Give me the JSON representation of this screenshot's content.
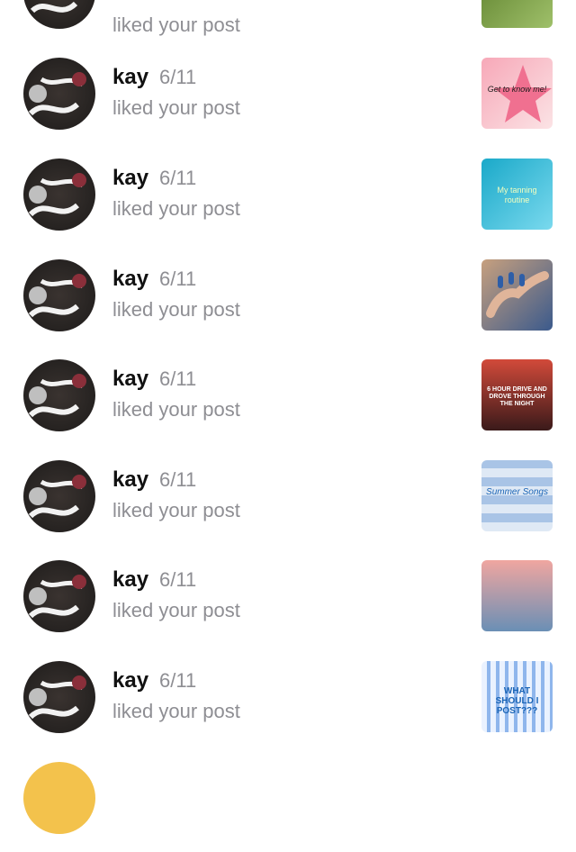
{
  "notifications": [
    {
      "name": "",
      "date": "",
      "action": "liked your post",
      "thumb": {
        "label": "",
        "colors": [
          "#5b7e2a",
          "#9fc06a"
        ]
      }
    },
    {
      "name": "kay",
      "date": "6/11",
      "action": "liked your post",
      "thumb": {
        "label": "Get to know me!",
        "colors": [
          "#f7a8b8",
          "#fbe3e5"
        ]
      }
    },
    {
      "name": "kay",
      "date": "6/11",
      "action": "liked your post",
      "thumb": {
        "label": "My tanning routine",
        "colors": [
          "#1aa9c9",
          "#7ad9ee"
        ]
      }
    },
    {
      "name": "kay",
      "date": "6/11",
      "action": "liked your post",
      "thumb": {
        "label": "",
        "colors": [
          "#c7a07e",
          "#3b5a8c"
        ]
      }
    },
    {
      "name": "kay",
      "date": "6/11",
      "action": "liked your post",
      "thumb": {
        "label": "6 HOUR DRIVE AND DROVE THROUGH THE NIGHT",
        "colors": [
          "#3a1a1a",
          "#d24a3a"
        ]
      }
    },
    {
      "name": "kay",
      "date": "6/11",
      "action": "liked your post",
      "thumb": {
        "label": "Summer Songs",
        "colors": [
          "#dfe9f5",
          "#a9c4e6"
        ]
      }
    },
    {
      "name": "kay",
      "date": "6/11",
      "action": "liked your post",
      "thumb": {
        "label": "",
        "colors": [
          "#f0a6a0",
          "#6a8fb5"
        ]
      }
    },
    {
      "name": "kay",
      "date": "6/11",
      "action": "liked your post",
      "thumb": {
        "label": "WHAT SHOULD I POST???",
        "colors": [
          "#eaf2ff",
          "#8fb6ec"
        ]
      }
    }
  ]
}
